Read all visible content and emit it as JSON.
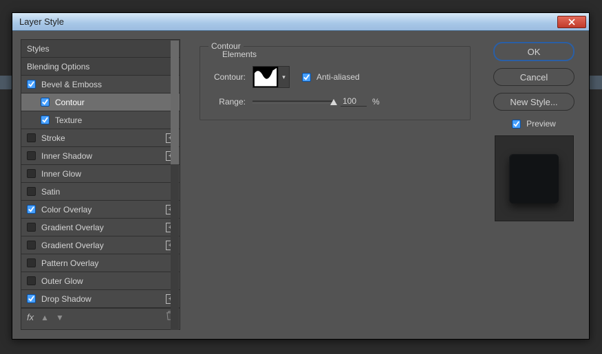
{
  "window": {
    "title": "Layer Style"
  },
  "list": {
    "items": [
      {
        "label": "Styles",
        "checkbox": false,
        "checked": false,
        "plus": false,
        "sub": false,
        "selected": false
      },
      {
        "label": "Blending Options",
        "checkbox": false,
        "checked": false,
        "plus": false,
        "sub": false,
        "selected": false
      },
      {
        "label": "Bevel & Emboss",
        "checkbox": true,
        "checked": true,
        "plus": false,
        "sub": false,
        "selected": false
      },
      {
        "label": "Contour",
        "checkbox": true,
        "checked": true,
        "plus": false,
        "sub": true,
        "selected": true
      },
      {
        "label": "Texture",
        "checkbox": true,
        "checked": true,
        "plus": false,
        "sub": true,
        "selected": false
      },
      {
        "label": "Stroke",
        "checkbox": true,
        "checked": false,
        "plus": true,
        "sub": false,
        "selected": false
      },
      {
        "label": "Inner Shadow",
        "checkbox": true,
        "checked": false,
        "plus": true,
        "sub": false,
        "selected": false
      },
      {
        "label": "Inner Glow",
        "checkbox": true,
        "checked": false,
        "plus": false,
        "sub": false,
        "selected": false
      },
      {
        "label": "Satin",
        "checkbox": true,
        "checked": false,
        "plus": false,
        "sub": false,
        "selected": false
      },
      {
        "label": "Color Overlay",
        "checkbox": true,
        "checked": true,
        "plus": true,
        "sub": false,
        "selected": false
      },
      {
        "label": "Gradient Overlay",
        "checkbox": true,
        "checked": false,
        "plus": true,
        "sub": false,
        "selected": false
      },
      {
        "label": "Gradient Overlay",
        "checkbox": true,
        "checked": false,
        "plus": true,
        "sub": false,
        "selected": false
      },
      {
        "label": "Pattern Overlay",
        "checkbox": true,
        "checked": false,
        "plus": false,
        "sub": false,
        "selected": false
      },
      {
        "label": "Outer Glow",
        "checkbox": true,
        "checked": false,
        "plus": false,
        "sub": false,
        "selected": false
      },
      {
        "label": "Drop Shadow",
        "checkbox": true,
        "checked": true,
        "plus": true,
        "sub": false,
        "selected": false
      }
    ],
    "footer_fx": "fx"
  },
  "panel": {
    "group_label": "Contour",
    "sub_label": "Elements",
    "contour_label": "Contour:",
    "anti_aliased_label": "Anti-aliased",
    "anti_aliased_checked": true,
    "range_label": "Range:",
    "range_value": "100",
    "range_unit": "%"
  },
  "buttons": {
    "ok": "OK",
    "cancel": "Cancel",
    "new_style": "New Style..."
  },
  "preview": {
    "label": "Preview",
    "checked": true
  }
}
